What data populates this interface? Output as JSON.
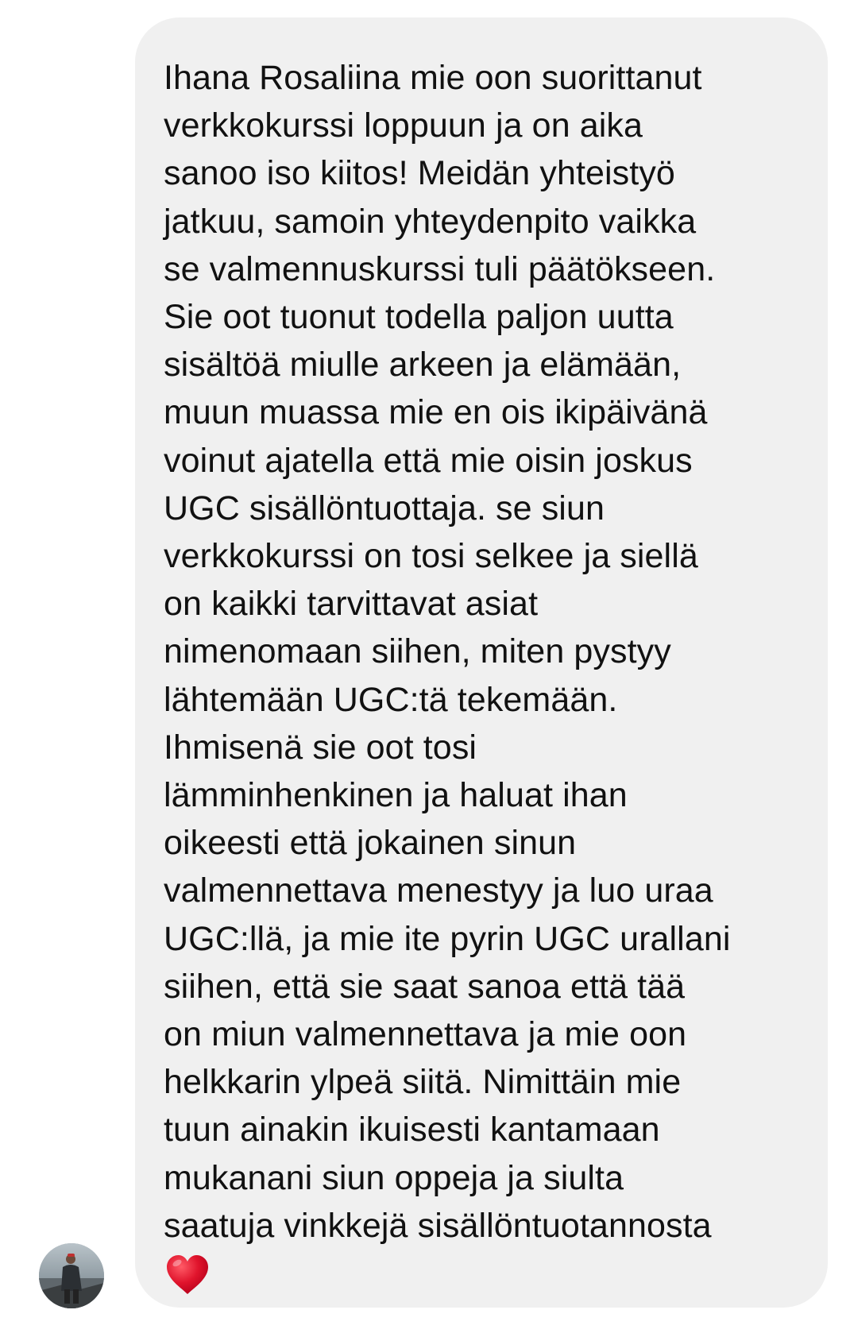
{
  "message": {
    "text": "Ihana Rosaliina mie oon suorittanut\nverkkokurssi loppuun ja on aika\nsanoo iso kiitos! Meidän yhteistyö\njatkuu, samoin yhteydenpito vaikka\nse valmennuskurssi tuli päätökseen.\nSie oot tuonut todella paljon uutta\nsisältöä miulle arkeen ja elämään,\nmuun muassa mie en ois ikipäivänä\nvoinut ajatella että mie oisin joskus\nUGC sisällöntuottaja. se siun\nverkkokurssi on tosi selkee ja siellä\non kaikki tarvittavat asiat\nnimenomaan siihen, miten pystyy\nlähtemään UGC:tä tekemään.\nIhmisenä sie oot tosi\nlämminhenkinen ja haluat ihan\noikeesti että jokainen sinun\nvalmennettava menestyy ja luo uraa\nUGC:llä, ja mie ite pyrin UGC urallani\nsiihen, että sie saat sanoa että tää\non miun valmennettava ja mie oon\nhelkkarin ylpeä siitä. Nimittäin mie\ntuun ainakin ikuisesti kantamaan\nmukanani siun oppeja ja siulta\nsaatuja vinkkejä sisällöntuotannosta",
    "emoji": "red-heart-emoji"
  },
  "colors": {
    "bubble": "#f0f0f0",
    "text": "#111111",
    "heart": "#e0142c"
  }
}
